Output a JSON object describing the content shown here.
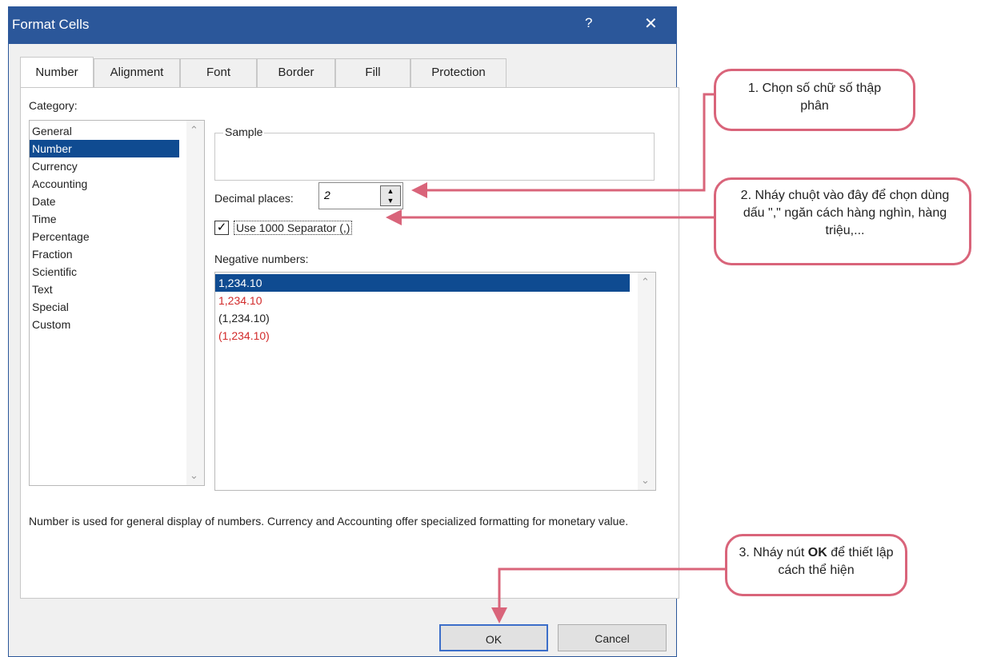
{
  "dialog": {
    "title": "Format Cells",
    "help_glyph": "?",
    "close_glyph": "✕",
    "tabs": [
      "Number",
      "Alignment",
      "Font",
      "Border",
      "Fill",
      "Protection"
    ],
    "active_tab": "Number"
  },
  "category": {
    "label": "Category:",
    "items": [
      "General",
      "Number",
      "Currency",
      "Accounting",
      "Date",
      "Time",
      "Percentage",
      "Fraction",
      "Scientific",
      "Text",
      "Special",
      "Custom"
    ],
    "selected": "Number"
  },
  "sample": {
    "legend": "Sample"
  },
  "decimal_places": {
    "label": "Decimal places:",
    "value": "2"
  },
  "separator": {
    "label": "Use 1000 Separator (,)",
    "checked": true
  },
  "negative_numbers": {
    "label": "Negative numbers:",
    "items": [
      {
        "text": "1,234.10",
        "color": "#ffffff",
        "selected": true
      },
      {
        "text": "1,234.10",
        "color": "#d22a2a",
        "selected": false
      },
      {
        "text": "(1,234.10)",
        "color": "#222222",
        "selected": false
      },
      {
        "text": "(1,234.10)",
        "color": "#d22a2a",
        "selected": false
      }
    ]
  },
  "description": "Number is used for general display of numbers.  Currency and Accounting offer specialized formatting for monetary value.",
  "buttons": {
    "ok": "OK",
    "cancel": "Cancel"
  },
  "callouts": {
    "c1": "1. Chọn số chữ số thập phân",
    "c2": "2. Nháy chuột vào đây để chọn dùng dấu \",\" ngăn cách hàng nghìn, hàng triệu,...",
    "c3_pre": "3. Nháy nút ",
    "c3_bold": "OK",
    "c3_post": " để thiết lập cách thể hiện"
  },
  "colors": {
    "title_bar": "#2b579a",
    "selection": "#0f4b91",
    "callout_border": "#d9647a",
    "negative_red": "#d22a2a"
  }
}
